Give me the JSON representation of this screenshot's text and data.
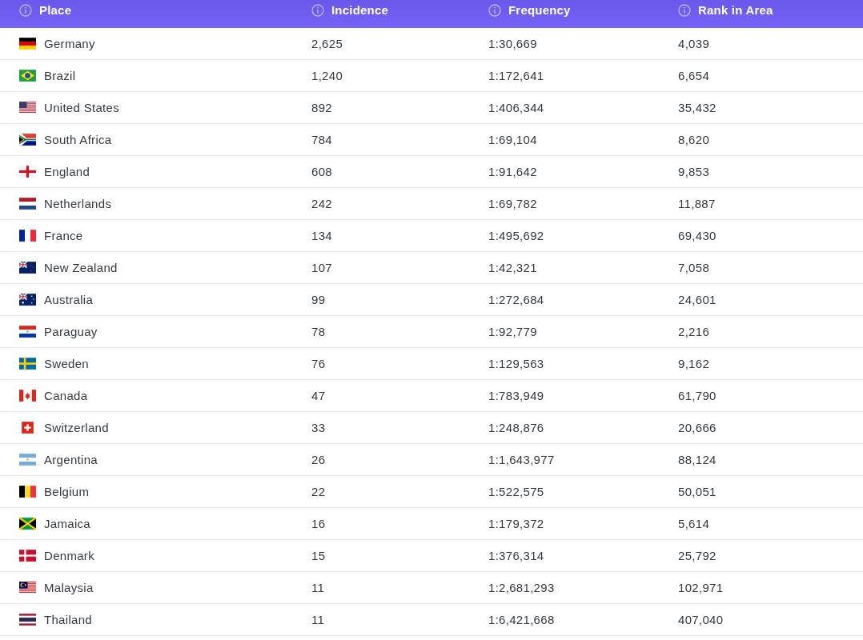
{
  "table": {
    "columns": [
      "Place",
      "Incidence",
      "Frequency",
      "Rank in Area"
    ],
    "rows": [
      {
        "place": "Germany",
        "incidence": "2,625",
        "frequency": "1:30,669",
        "rank_in_area": "4,039"
      },
      {
        "place": "Brazil",
        "incidence": "1,240",
        "frequency": "1:172,641",
        "rank_in_area": "6,654"
      },
      {
        "place": "United States",
        "incidence": "892",
        "frequency": "1:406,344",
        "rank_in_area": "35,432"
      },
      {
        "place": "South Africa",
        "incidence": "784",
        "frequency": "1:69,104",
        "rank_in_area": "8,620"
      },
      {
        "place": "England",
        "incidence": "608",
        "frequency": "1:91,642",
        "rank_in_area": "9,853"
      },
      {
        "place": "Netherlands",
        "incidence": "242",
        "frequency": "1:69,782",
        "rank_in_area": "11,887"
      },
      {
        "place": "France",
        "incidence": "134",
        "frequency": "1:495,692",
        "rank_in_area": "69,430"
      },
      {
        "place": "New Zealand",
        "incidence": "107",
        "frequency": "1:42,321",
        "rank_in_area": "7,058"
      },
      {
        "place": "Australia",
        "incidence": "99",
        "frequency": "1:272,684",
        "rank_in_area": "24,601"
      },
      {
        "place": "Paraguay",
        "incidence": "78",
        "frequency": "1:92,779",
        "rank_in_area": "2,216"
      },
      {
        "place": "Sweden",
        "incidence": "76",
        "frequency": "1:129,563",
        "rank_in_area": "9,162"
      },
      {
        "place": "Canada",
        "incidence": "47",
        "frequency": "1:783,949",
        "rank_in_area": "61,790"
      },
      {
        "place": "Switzerland",
        "incidence": "33",
        "frequency": "1:248,876",
        "rank_in_area": "20,666"
      },
      {
        "place": "Argentina",
        "incidence": "26",
        "frequency": "1:1,643,977",
        "rank_in_area": "88,124"
      },
      {
        "place": "Belgium",
        "incidence": "22",
        "frequency": "1:522,575",
        "rank_in_area": "50,051"
      },
      {
        "place": "Jamaica",
        "incidence": "16",
        "frequency": "1:179,372",
        "rank_in_area": "5,614"
      },
      {
        "place": "Denmark",
        "incidence": "15",
        "frequency": "1:376,314",
        "rank_in_area": "25,792"
      },
      {
        "place": "Malaysia",
        "incidence": "11",
        "frequency": "1:2,681,293",
        "rank_in_area": "102,971"
      },
      {
        "place": "Thailand",
        "incidence": "11",
        "frequency": "1:6,421,668",
        "rank_in_area": "407,040"
      }
    ]
  }
}
